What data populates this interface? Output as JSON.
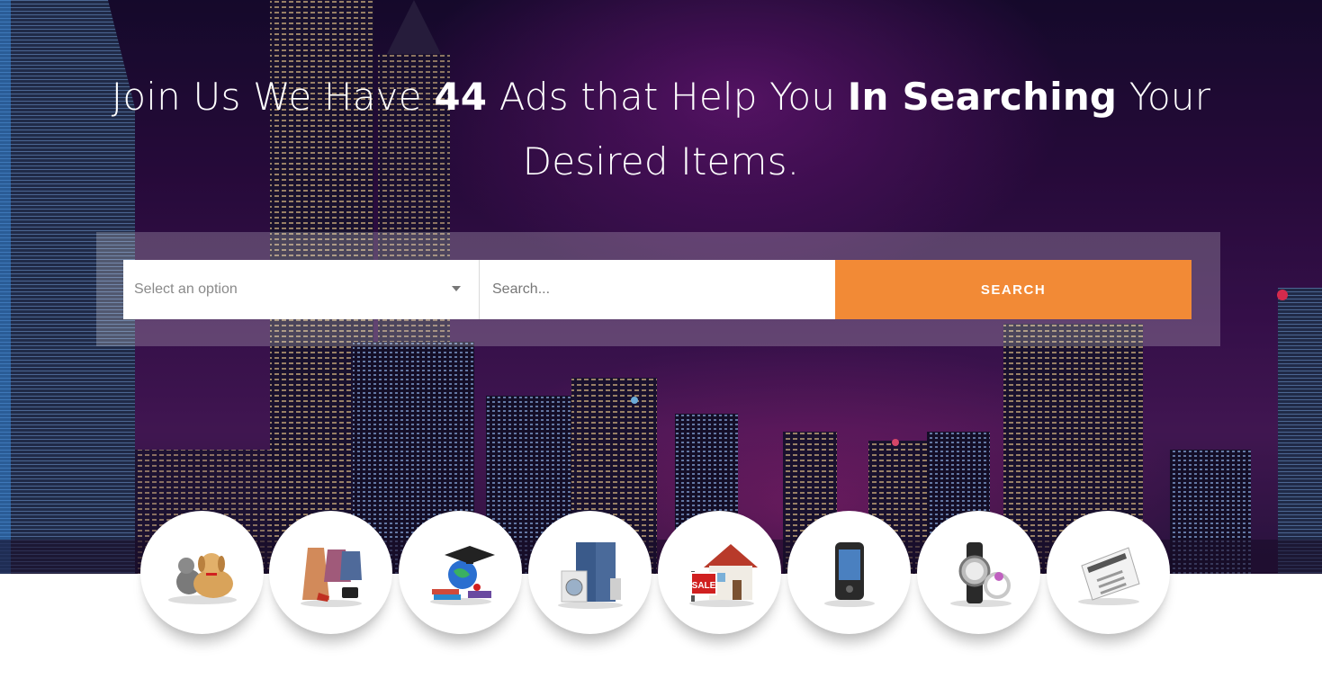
{
  "hero": {
    "headline_part1": "Join Us We Have ",
    "ads_count": "44",
    "headline_part2": " Ads that Help You ",
    "headline_bold": "In Searching",
    "headline_part3": " Your",
    "headline_line2": "Desired Items."
  },
  "search": {
    "select_placeholder": "Select an option",
    "input_placeholder": "Search...",
    "button_label": "SEARCH"
  },
  "colors": {
    "accent": "#f28a36",
    "panel": "rgba(255,255,255,0.22)"
  },
  "categories": [
    {
      "icon": "pets-icon"
    },
    {
      "icon": "clothing-icon"
    },
    {
      "icon": "education-icon"
    },
    {
      "icon": "appliances-icon"
    },
    {
      "icon": "real-estate-icon"
    },
    {
      "icon": "mobile-phone-icon"
    },
    {
      "icon": "jewelry-watch-icon"
    },
    {
      "icon": "newspaper-icon"
    }
  ]
}
